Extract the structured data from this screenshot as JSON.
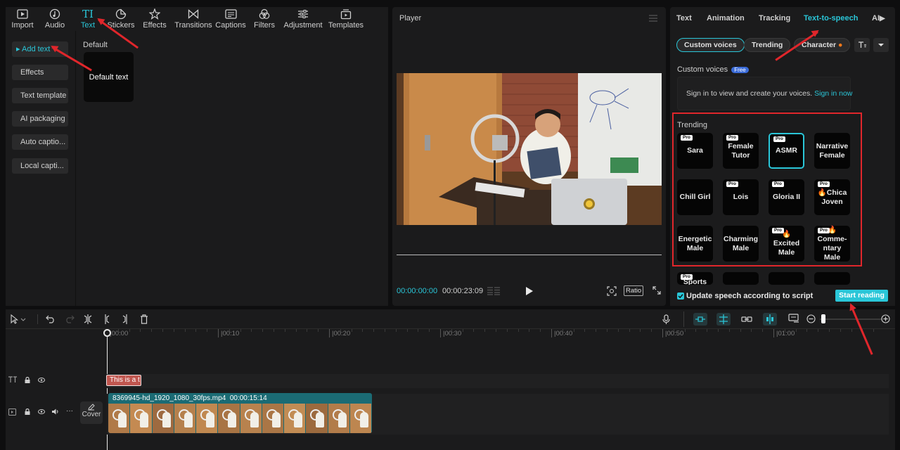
{
  "toolbar": {
    "items": [
      {
        "label": "Import",
        "icon": "import-icon"
      },
      {
        "label": "Audio",
        "icon": "audio-icon"
      },
      {
        "label": "Text",
        "icon": "text-icon",
        "active": true
      },
      {
        "label": "Stickers",
        "icon": "stickers-icon"
      },
      {
        "label": "Effects",
        "icon": "effects-icon"
      },
      {
        "label": "Transitions",
        "icon": "transitions-icon"
      },
      {
        "label": "Captions",
        "icon": "captions-icon"
      },
      {
        "label": "Filters",
        "icon": "filters-icon"
      },
      {
        "label": "Adjustment",
        "icon": "adjustment-icon"
      },
      {
        "label": "Templates",
        "icon": "templates-icon"
      }
    ]
  },
  "text_nav": {
    "items": [
      "Add text",
      "Effects",
      "Text template",
      "AI packaging",
      "Auto captio...",
      "Local capti..."
    ]
  },
  "text_content": {
    "section": "Default",
    "tile": "Default text"
  },
  "player": {
    "title": "Player",
    "current_time": "00:00:00:00",
    "duration": "00:00:23:09",
    "ratio_label": "Ratio"
  },
  "right_panel": {
    "tabs": [
      "Text",
      "Animation",
      "Tracking",
      "Text-to-speech",
      "AI"
    ],
    "active_tab": "Text-to-speech",
    "pills": [
      "Custom voices",
      "Trending",
      "Character"
    ],
    "custom_voices_label": "Custom voices",
    "free_badge": "Free",
    "sign_in_text": "Sign in to view and create your voices.",
    "sign_in_link": "Sign in now",
    "trending_label": "Trending",
    "pro_badge": "Pro",
    "voices": [
      {
        "name": "Sara",
        "pro": true
      },
      {
        "name": "Female Tutor",
        "pro": true
      },
      {
        "name": "ASMR",
        "pro": true,
        "selected": true
      },
      {
        "name": "Narrative Female",
        "pro": false
      },
      {
        "name": "Chill Girl",
        "pro": false
      },
      {
        "name": "Lois",
        "pro": true
      },
      {
        "name": "Gloria II",
        "pro": true
      },
      {
        "name": "🔥Chica Joven",
        "pro": true
      },
      {
        "name": "Energetic Male",
        "pro": false
      },
      {
        "name": "Charming Male",
        "pro": false
      },
      {
        "name": "🔥Excited Male",
        "pro": true
      },
      {
        "name": "🔥Comme-ntary Male",
        "pro": true
      },
      {
        "name": "Sports",
        "pro": true
      }
    ],
    "update_checkbox_label": "Update speech according to script",
    "start_button": "Start reading"
  },
  "timeline": {
    "ruler": [
      "00:00",
      "00:10",
      "00:20",
      "00:30",
      "00:40",
      "00:50",
      "01:00"
    ],
    "text_clip": "This is a t",
    "video_clip": "8369945-hd_1920_1080_30fps.mp4",
    "video_clip_duration": "00:00:15:14",
    "cover_label": "Cover"
  },
  "colors": {
    "accent": "#2ac6d8",
    "annotation": "#e0262b",
    "text_clip": "#c0564f",
    "video_track": "#1b6b74"
  }
}
